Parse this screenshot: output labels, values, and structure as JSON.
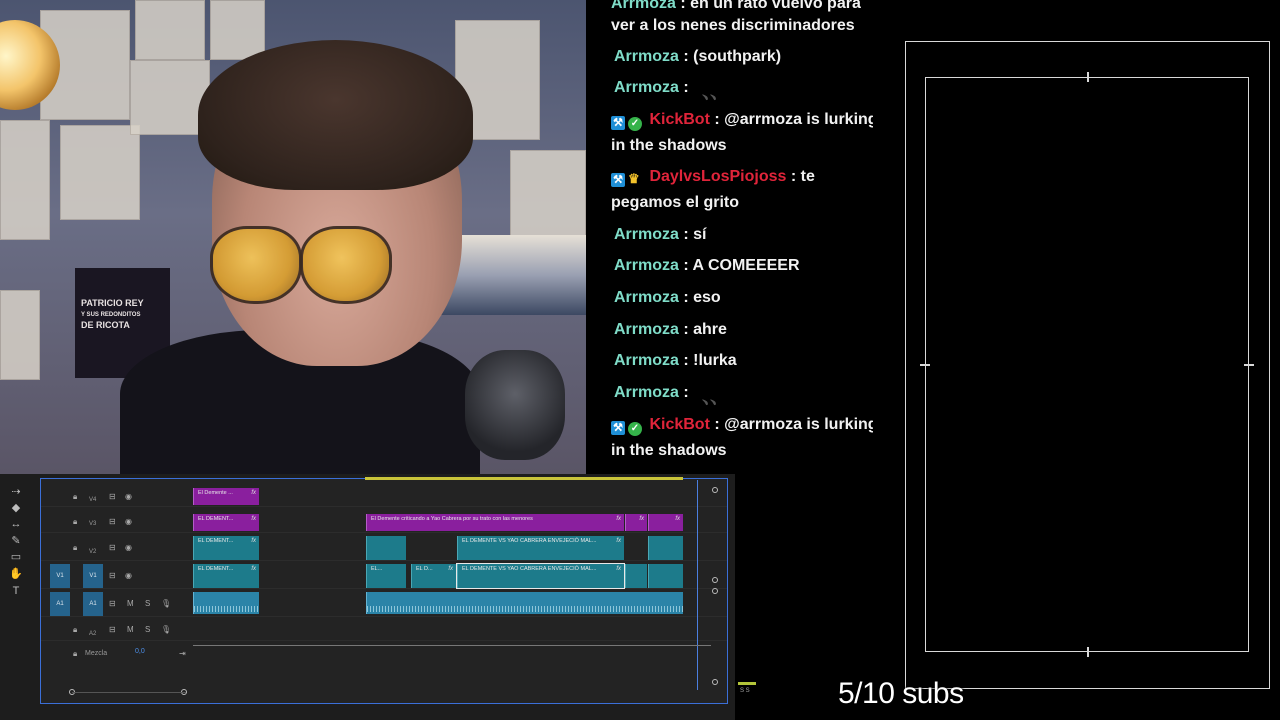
{
  "chat": {
    "colors": {
      "arrmoza": "#7fdcc8",
      "kickbot": "#e0243a",
      "daylvs": "#e0243a"
    },
    "messages": [
      {
        "author": "Arrmoza",
        "text": ": en un rato vuelvo para"
      },
      {
        "author": "",
        "text": "ver a los nenes discriminadores"
      },
      {
        "author": "Arrmoza",
        "text": ": (southpark)"
      },
      {
        "author": "Arrmoza",
        "text": ":"
      },
      {
        "author": "KickBot",
        "text": ": @arrmoza is lurking"
      },
      {
        "author": "",
        "text": "in the shadows"
      },
      {
        "author": "DaylvsLosPiojoss",
        "text": ": te"
      },
      {
        "author": "",
        "text": "pegamos el grito"
      },
      {
        "author": "Arrmoza",
        "text": ": sí"
      },
      {
        "author": "Arrmoza",
        "text": ": A COMEEEER"
      },
      {
        "author": "Arrmoza",
        "text": ": eso"
      },
      {
        "author": "Arrmoza",
        "text": ": ahre"
      },
      {
        "author": "Arrmoza",
        "text": ": !lurka"
      },
      {
        "author": "Arrmoza",
        "text": ":"
      },
      {
        "author": "KickBot",
        "text": ": @arrmoza is lurking"
      },
      {
        "author": "",
        "text": "in the shadows"
      }
    ]
  },
  "webcam": {
    "poster_text": [
      "PATRICIO REY",
      "Y SUS REDONDITOS",
      "DE RICOTA"
    ]
  },
  "timeline": {
    "tracks": {
      "v4": "V4",
      "v3": "V3",
      "v2": "V2",
      "v1": "V1",
      "a1": "A1",
      "a2": "A2",
      "src_v1": "V1",
      "src_a1": "A1",
      "mute": "M",
      "solo": "S"
    },
    "mezcla_label": "Mezcla",
    "mezcla_value": "0,0",
    "clips": {
      "v4_a": "El Demente ...",
      "v3_a": "EL DEMENT...",
      "v3_b": "El Demente criticando a Yao Cabrera por su trato con las menores",
      "v2_a": "EL DEMENT...",
      "v2_b": "EL DEMENTE VS YAO CABRERA ENVEJECIÓ MAL...",
      "v1_a": "EL DEMENT...",
      "v1_b": "EL D...",
      "v1_c": "EL DEMENTE VS YAO CABRERA ENVEJECIÓ MAL...",
      "v1_small": "EL...",
      "fx": "fx"
    },
    "meter_label": "S S"
  },
  "overlay": {
    "subs": "5/10 subs"
  }
}
